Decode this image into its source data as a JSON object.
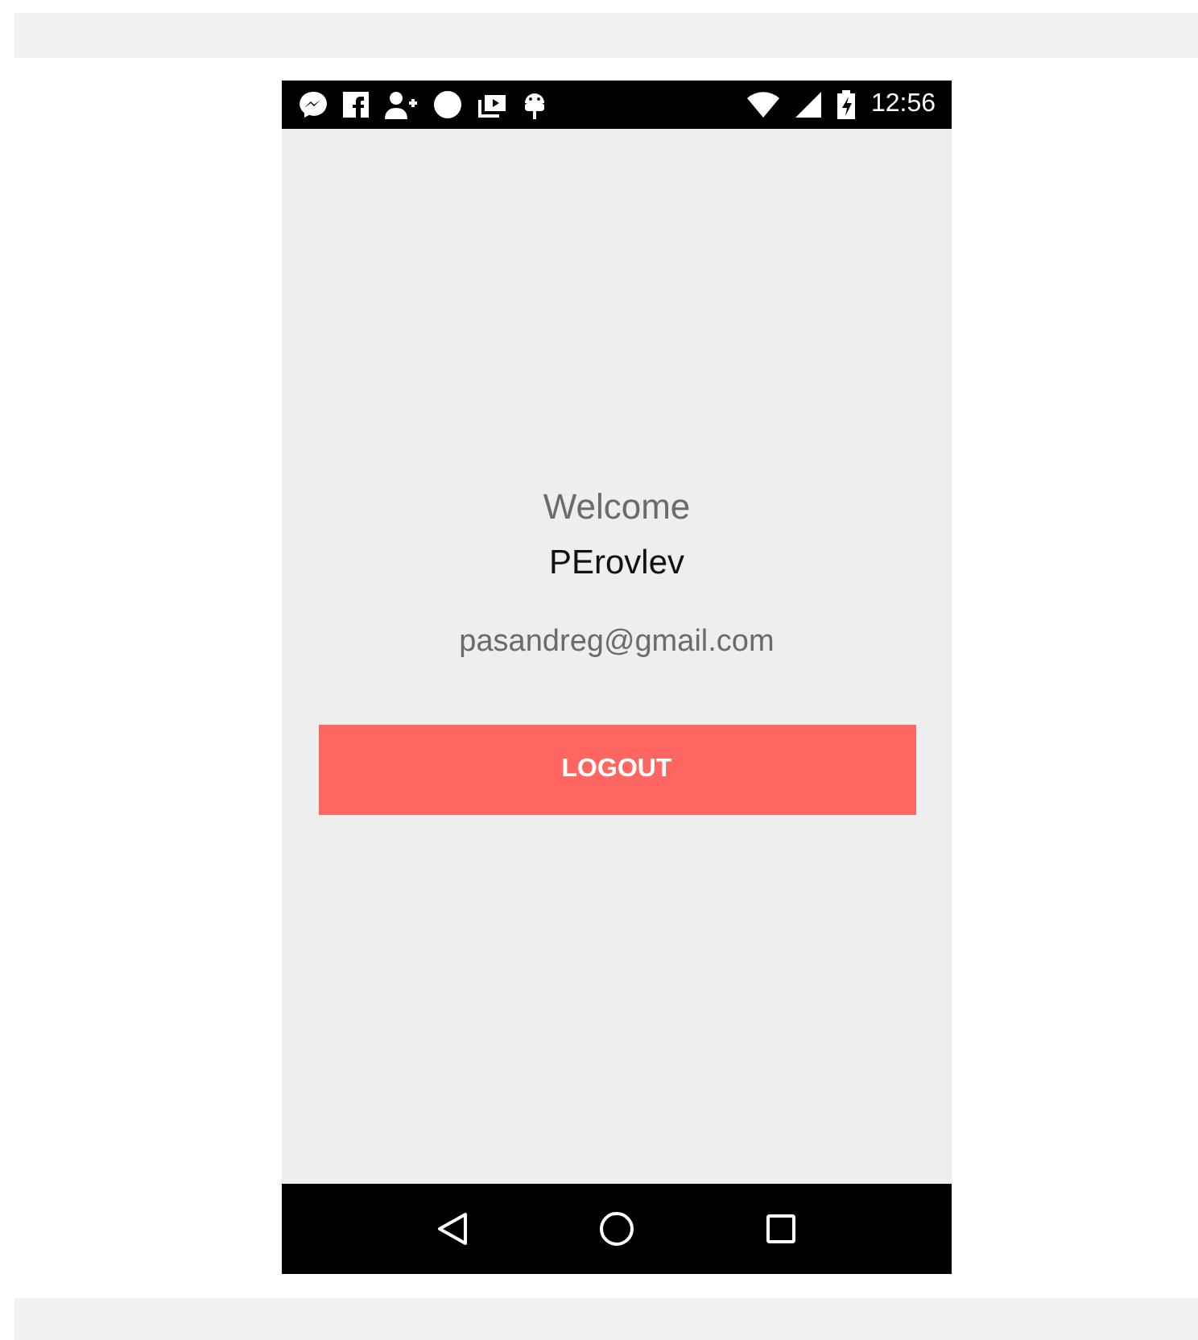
{
  "status_bar": {
    "time": "12:56"
  },
  "profile": {
    "greeting": "Welcome",
    "name": "PErovlev",
    "email": "pasandreg@gmail.com"
  },
  "logout_button": {
    "label": "LOGOUT"
  }
}
